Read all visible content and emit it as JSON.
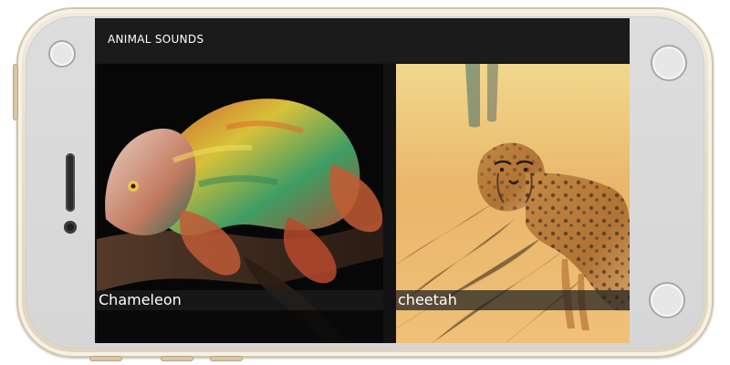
{
  "app": {
    "title": "ANIMAL SOUNDS"
  },
  "tiles": [
    {
      "label": "Chameleon",
      "image_icon": "chameleon-photo"
    },
    {
      "label": "cheetah",
      "image_icon": "cheetah-photo"
    }
  ],
  "colors": {
    "app_bar": "#1b1b1b",
    "screen_bg": "#171717",
    "label_bar": "rgba(30,30,30,0.72)"
  }
}
